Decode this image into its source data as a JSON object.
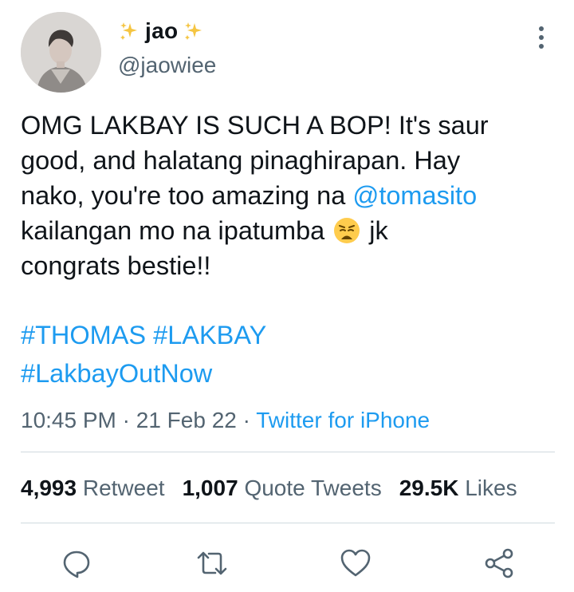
{
  "tweet": {
    "display_name": "jao",
    "handle": "@jaowiee",
    "text_lines": [
      "OMG LAKBAY IS SUCH A BOP! It's saur",
      "good, and halatang pinaghirapan. Hay"
    ],
    "line3_prefix": "nako, you're too amazing na ",
    "mention": "@tomasito",
    "line4_prefix": "kailangan mo na ipatumba ",
    "line4_suffix": " jk",
    "line5": "congrats bestie!!",
    "hashtags_line1": "#THOMAS #LAKBAY",
    "hashtags_line2": "#LakbayOutNow",
    "time": "10:45 PM",
    "date": "21 Feb 22",
    "separator": " · ",
    "source": "Twitter for iPhone"
  },
  "stats": {
    "retweets_count": "4,993",
    "retweets_label": "Retweet",
    "quotes_count": "1,007",
    "quotes_label": "Quote Tweets",
    "likes_count": "29.5K",
    "likes_label": "Likes"
  },
  "icons": {
    "sparkle": "sparkles-emoji",
    "emoji": "weary-face-emoji",
    "reply": "reply-icon",
    "retweet": "retweet-icon",
    "like": "heart-icon",
    "share": "share-icon"
  },
  "colors": {
    "link": "#1d9bf0",
    "secondary_text": "#536471",
    "text": "#0f1419",
    "divider": "#cfd9de"
  }
}
